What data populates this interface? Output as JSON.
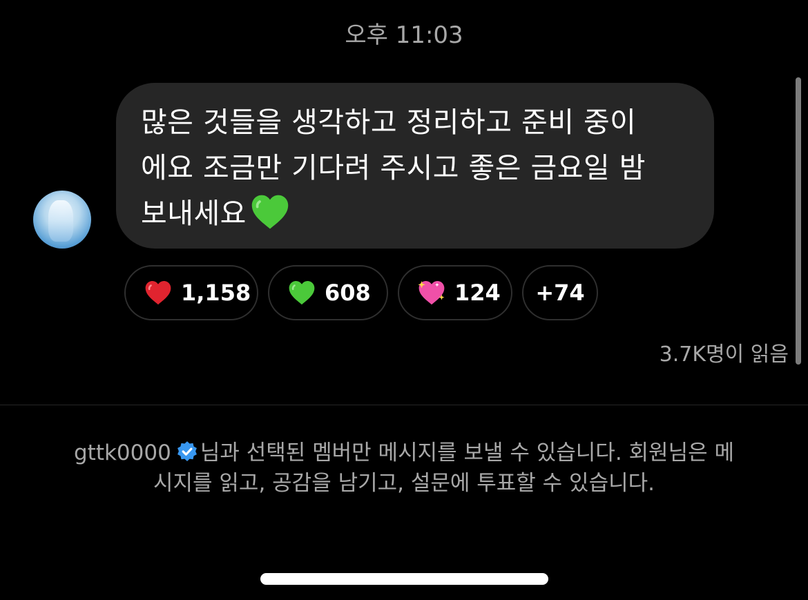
{
  "header": {
    "timestamp": "오후 11:03"
  },
  "message": {
    "text_line1": "많은 것들을 생각하고 정리하고 준비 중이",
    "text_line2": "에요 조금만 기다려 주시고 좋은 금요일 밤",
    "text_line3": "보내세요",
    "trailing_emoji": "green-heart-icon"
  },
  "reactions": [
    {
      "emoji": "red-heart-icon",
      "count": "1,158"
    },
    {
      "emoji": "green-heart-icon",
      "count": "608"
    },
    {
      "emoji": "sparkling-heart-icon",
      "count": "124"
    },
    {
      "emoji": null,
      "count": "+74"
    }
  ],
  "read_receipt": "3.7K명이 읽음",
  "notice": {
    "username": "gttk0000",
    "line1_rest": "님과 선택된 멤버만 메시지를 보낼 수 있습니다. 회원님은 메",
    "line2": "시지를 읽고, 공감을 남기고, 설문에 투표할 수 있습니다."
  },
  "colors": {
    "background": "#000000",
    "bubble": "#262626",
    "secondary_text": "#a8a8a8",
    "verified_blue": "#3897f0",
    "heart_red": "#e0242f",
    "heart_green": "#4bc93a",
    "heart_pink": "#f050a8"
  }
}
